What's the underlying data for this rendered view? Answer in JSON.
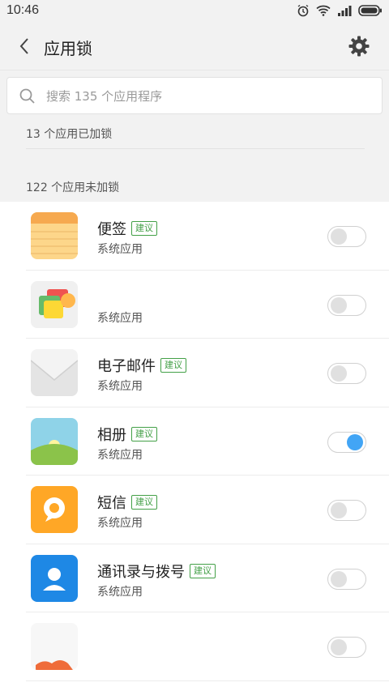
{
  "status": {
    "time": "10:46"
  },
  "header": {
    "title": "应用锁",
    "back_icon": "back-arrow-icon",
    "settings_icon": "gear-icon"
  },
  "search": {
    "placeholder": "搜索 135 个应用程序"
  },
  "sections": {
    "locked": "13 个应用已加锁",
    "unlocked": "122 个应用未加锁"
  },
  "apps": [
    {
      "name": "便签",
      "badge": "建议",
      "subtitle": "系统应用",
      "locked": false,
      "icon": "notes-icon"
    },
    {
      "name": "",
      "badge": "",
      "subtitle": "系统应用",
      "locked": false,
      "icon": "theme-icon"
    },
    {
      "name": "电子邮件",
      "badge": "建议",
      "subtitle": "系统应用",
      "locked": false,
      "icon": "email-icon"
    },
    {
      "name": "相册",
      "badge": "建议",
      "subtitle": "系统应用",
      "locked": true,
      "icon": "gallery-icon"
    },
    {
      "name": "短信",
      "badge": "建议",
      "subtitle": "系统应用",
      "locked": false,
      "icon": "sms-icon"
    },
    {
      "name": "通讯录与拨号",
      "badge": "建议",
      "subtitle": "系统应用",
      "locked": false,
      "icon": "contacts-icon"
    },
    {
      "name": "",
      "badge": "",
      "subtitle": "",
      "locked": false,
      "icon": "app-icon"
    }
  ],
  "colors": {
    "accent": "#42a5f5",
    "badge": "#43a047",
    "background": "#f2f2f2"
  }
}
